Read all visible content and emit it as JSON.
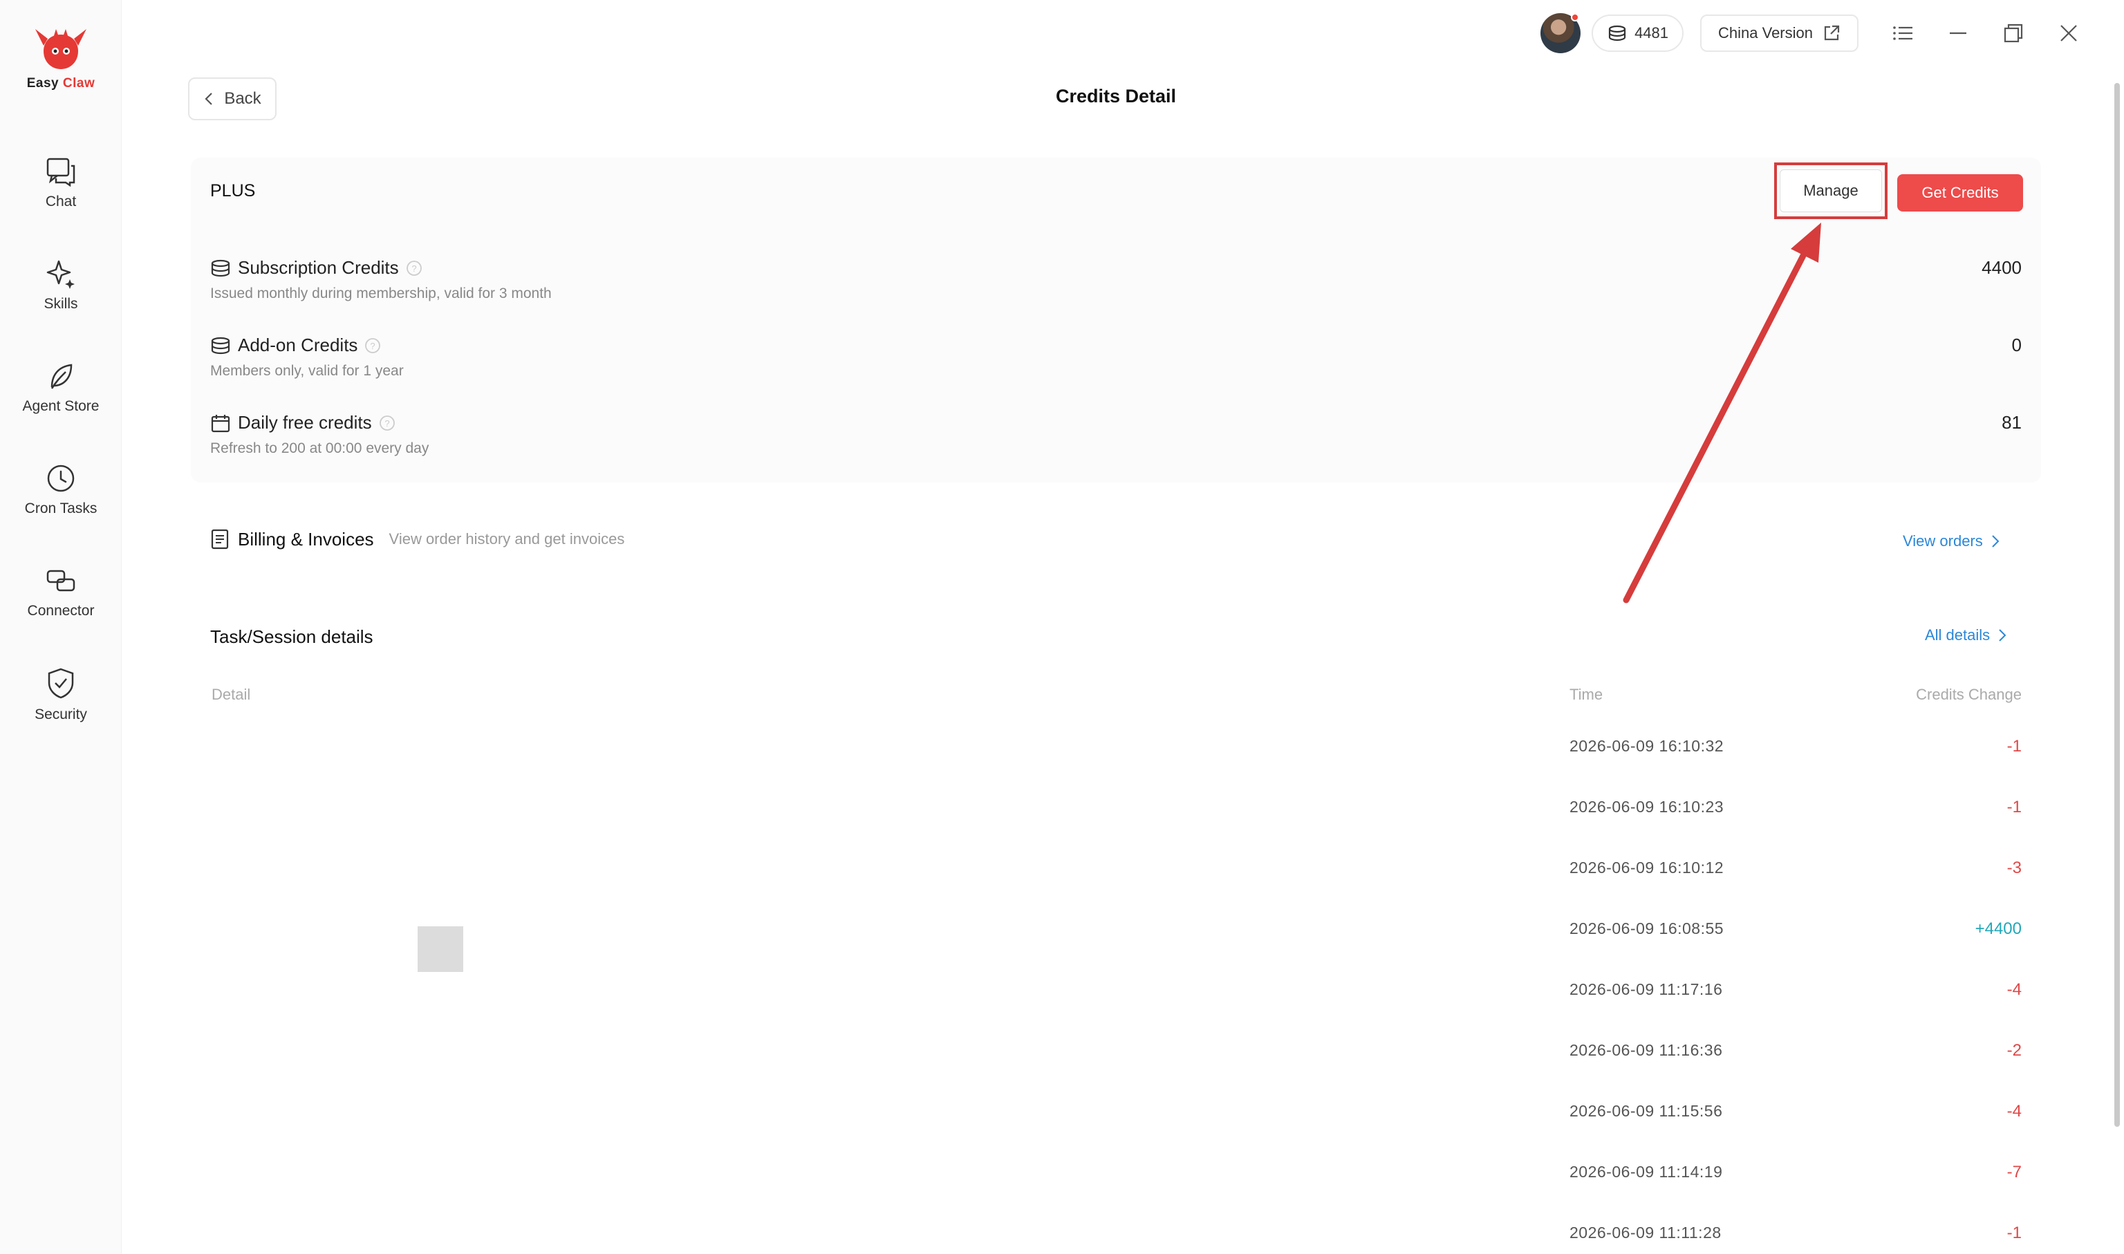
{
  "app": {
    "logo_word1": "Easy",
    "logo_word2": "Claw",
    "accent_color": "#e53935"
  },
  "sidebar": {
    "items": [
      {
        "label": "Chat",
        "icon": "chat-icon"
      },
      {
        "label": "Skills",
        "icon": "sparkle-icon"
      },
      {
        "label": "Agent Store",
        "icon": "leaf-icon"
      },
      {
        "label": "Cron Tasks",
        "icon": "clock-icon"
      },
      {
        "label": "Connector",
        "icon": "link-icon"
      },
      {
        "label": "Security",
        "icon": "shield-icon"
      }
    ]
  },
  "topbar": {
    "credits_count": "4481",
    "version_label": "China Version"
  },
  "header": {
    "back_label": "Back",
    "title": "Credits Detail"
  },
  "plan_card": {
    "plan_name": "PLUS",
    "manage_label": "Manage",
    "get_credits_label": "Get Credits",
    "rows": [
      {
        "title": "Subscription Credits",
        "subtitle": "Issued monthly during membership, valid for 3 month",
        "value": "4400"
      },
      {
        "title": "Add-on Credits",
        "subtitle": "Members only, valid for 1 year",
        "value": "0"
      },
      {
        "title": "Daily free credits",
        "subtitle": "Refresh to 200 at 00:00 every day",
        "value": "81"
      }
    ]
  },
  "billing": {
    "title": "Billing & Invoices",
    "description": "View order history and get invoices",
    "link_label": "View orders"
  },
  "tasks": {
    "title": "Task/Session details",
    "all_details_label": "All details",
    "columns": {
      "detail": "Detail",
      "time": "Time",
      "change": "Credits Change"
    },
    "rows": [
      {
        "time": "2026-06-09 16:10:32",
        "change": "-1"
      },
      {
        "time": "2026-06-09 16:10:23",
        "change": "-1"
      },
      {
        "time": "2026-06-09 16:10:12",
        "change": "-3"
      },
      {
        "time": "2026-06-09 16:08:55",
        "change": "+4400"
      },
      {
        "time": "2026-06-09 11:17:16",
        "change": "-4"
      },
      {
        "time": "2026-06-09 11:16:36",
        "change": "-2"
      },
      {
        "time": "2026-06-09 11:15:56",
        "change": "-4"
      },
      {
        "time": "2026-06-09 11:14:19",
        "change": "-7"
      },
      {
        "time": "2026-06-09 11:11:28",
        "change": "-1"
      }
    ]
  },
  "colors": {
    "primary_red": "#ee4b4b",
    "highlight_red": "#d63c3c",
    "link_blue": "#2b87d8",
    "positive_teal": "#22a8b8",
    "negative_red": "#e04848"
  }
}
